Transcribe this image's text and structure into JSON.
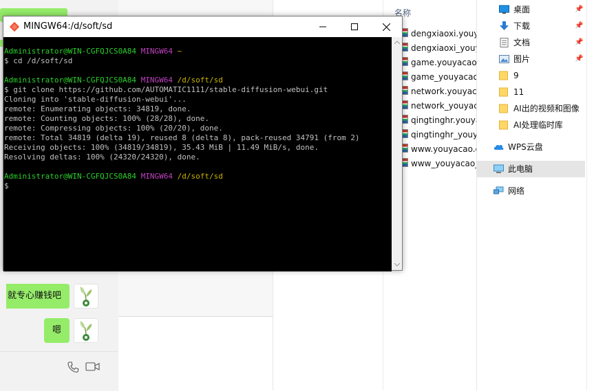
{
  "chat": {
    "messages": [
      {
        "text": "就专心赚钱吧",
        "side": "right"
      },
      {
        "text": "嗯",
        "side": "right"
      }
    ],
    "toolbar_icons": [
      "phone-icon",
      "video-call-icon"
    ]
  },
  "file_list": {
    "header": "名称",
    "files": [
      "dengxiaoxi.youya",
      "dengxiaoxi_youya",
      "game.youyacao.c",
      "game_youyacao_",
      "network.youyaca",
      "network_youyaca",
      "qingtinghr.youya",
      "qingtinghr_youya",
      "www.youyacao.cr",
      "www_youyacao_c"
    ]
  },
  "nav_pane": {
    "items": [
      {
        "label": "桌面",
        "icon": "desktop-icon",
        "pinned": true
      },
      {
        "label": "下载",
        "icon": "download-icon",
        "pinned": true
      },
      {
        "label": "文档",
        "icon": "document-icon",
        "pinned": true
      },
      {
        "label": "图片",
        "icon": "picture-icon",
        "pinned": true
      },
      {
        "label": "9",
        "icon": "folder-icon",
        "pinned": false
      },
      {
        "label": "11",
        "icon": "folder-icon",
        "pinned": false
      },
      {
        "label": "AI出的视频和图像",
        "icon": "folder-icon",
        "pinned": false
      },
      {
        "label": "AI处理临时库",
        "icon": "folder-icon",
        "pinned": false
      },
      {
        "label": "WPS云盘",
        "icon": "cloud-icon",
        "pinned": false
      },
      {
        "label": "此电脑",
        "icon": "computer-icon",
        "pinned": false,
        "selected": true
      },
      {
        "label": "网络",
        "icon": "network-icon",
        "pinned": false
      }
    ]
  },
  "terminal": {
    "title": "MINGW64:/d/soft/sd",
    "colors": {
      "user": "#2ad12a",
      "shell": "#c040c0",
      "path": "#c8b400",
      "text": "#c0c0c0",
      "background": "#000000"
    },
    "lines": [
      {
        "user": "Administrator@WIN-CGFQJCS0A84",
        "shell": "MINGW64",
        "path": "~"
      },
      {
        "text": "$ cd /d/soft/sd"
      },
      {
        "text": ""
      },
      {
        "user": "Administrator@WIN-CGFQJCS0A84",
        "shell": "MINGW64",
        "path": "/d/soft/sd"
      },
      {
        "text": "$ git clone https://github.com/AUTOMATIC1111/stable-diffusion-webui.git"
      },
      {
        "text": "Cloning into 'stable-diffusion-webui'..."
      },
      {
        "text": "remote: Enumerating objects: 34819, done."
      },
      {
        "text": "remote: Counting objects: 100% (28/28), done."
      },
      {
        "text": "remote: Compressing objects: 100% (20/20), done."
      },
      {
        "text": "remote: Total 34819 (delta 19), reused 8 (delta 8), pack-reused 34791 (from 2)"
      },
      {
        "text": "Receiving objects: 100% (34819/34819), 35.43 MiB | 11.49 MiB/s, done."
      },
      {
        "text": "Resolving deltas: 100% (24320/24320), done."
      },
      {
        "text": ""
      },
      {
        "user": "Administrator@WIN-CGFQJCS0A84",
        "shell": "MINGW64",
        "path": "/d/soft/sd"
      },
      {
        "text": "$"
      }
    ]
  }
}
